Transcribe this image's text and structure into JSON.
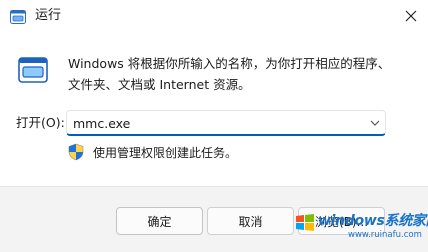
{
  "window": {
    "title": "运行",
    "app_icon": "run-app-icon",
    "close_icon": "close-icon"
  },
  "content": {
    "run_icon": "run-icon",
    "description_line1": "Windows 将根据你所输入的名称，为你打开相应的程序、",
    "description_line2": "文件夹、文档或 Internet 资源。",
    "open_label": "打开(O):",
    "open_value": "mmc.exe",
    "shield_icon": "uac-shield-icon",
    "admin_note": "使用管理权限创建此任务。"
  },
  "footer": {
    "ok_label": "确定",
    "cancel_label": "取消",
    "browse_label": "浏览(B)..."
  },
  "watermark": {
    "brand": "windows系统家园",
    "url": "www.ruinafu.com"
  },
  "colors": {
    "accent": "#005fb8",
    "footer_bg": "#f3f3f3"
  }
}
